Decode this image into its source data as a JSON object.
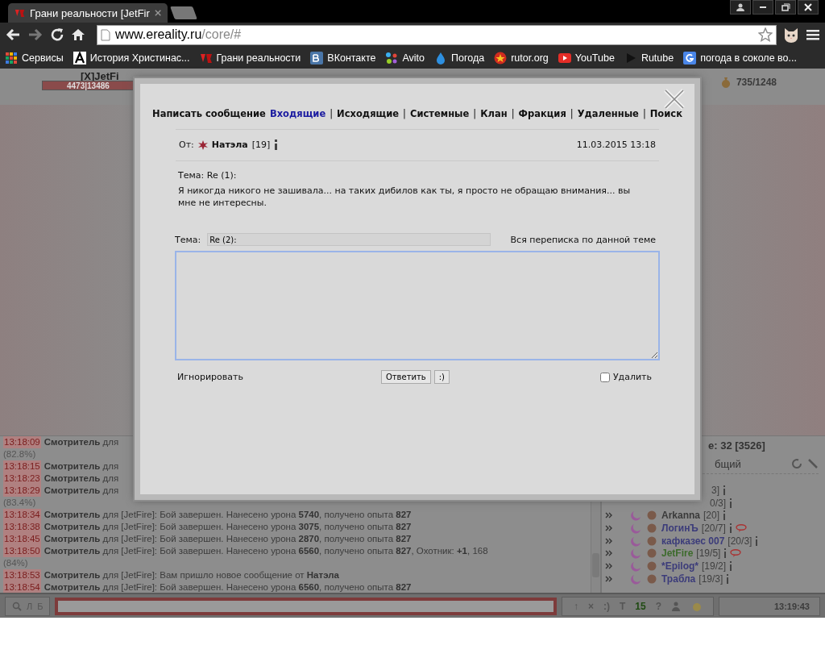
{
  "browser": {
    "tab_title": "Грани реальности [JetFir",
    "url_host": "www.ereality.ru",
    "url_path": "/core/#",
    "bookmarks": [
      {
        "label": "Сервисы",
        "kind": "apps"
      },
      {
        "label": "История Христинас...",
        "kind": "letter"
      },
      {
        "label": "Грани реальности",
        "kind": "logo"
      },
      {
        "label": "ВКонтакте",
        "kind": "vk"
      },
      {
        "label": "Avito",
        "kind": "dots"
      },
      {
        "label": "Погода",
        "kind": "drop"
      },
      {
        "label": "rutor.org",
        "kind": "star"
      },
      {
        "label": "YouTube",
        "kind": "play"
      },
      {
        "label": "Rutube",
        "kind": "triangle"
      },
      {
        "label": "погода в соколе во...",
        "kind": "search"
      }
    ]
  },
  "game": {
    "player": "[X]JetFi",
    "hp": "4473|13486",
    "money": "735/1248",
    "chat_log": [
      {
        "kind": "line",
        "time": "13:18:09",
        "text": "**Смотритель** для"
      },
      {
        "kind": "cont",
        "text": "(82.8%)"
      },
      {
        "kind": "line",
        "time": "13:18:15",
        "text": "**Смотритель** для"
      },
      {
        "kind": "line",
        "time": "13:18:23",
        "text": "**Смотритель** для"
      },
      {
        "kind": "line",
        "time": "13:18:29",
        "text": "**Смотритель** для"
      },
      {
        "kind": "cont",
        "text": "(83.4%)"
      },
      {
        "kind": "line",
        "time": "13:18:34",
        "text": "**Смотритель** для [JetFire]: Бой завершен. Нанесено урона **5740**, получено опыта **827**"
      },
      {
        "kind": "line",
        "time": "13:18:38",
        "text": "**Смотритель** для [JetFire]: Бой завершен. Нанесено урона **3075**, получено опыта **827**"
      },
      {
        "kind": "line",
        "time": "13:18:45",
        "text": "**Смотритель** для [JetFire]: Бой завершен. Нанесено урона **2870**, получено опыта **827**"
      },
      {
        "kind": "line",
        "time": "13:18:50",
        "text": "**Смотритель** для [JetFire]: Бой завершен. Нанесено урона **6560**, получено опыта **827**, Охотник: **+1**, 168"
      },
      {
        "kind": "cont",
        "text": "(84%)"
      },
      {
        "kind": "line",
        "time": "13:18:53",
        "text": "**Смотритель** для [JetFire]: Вам пришло новое сообщение от **Натэла**"
      },
      {
        "kind": "line",
        "time": "13:18:54",
        "text": "**Смотритель** для [JetFire]: Бой завершен. Нанесено урона **6560**, получено опыта **827**"
      }
    ],
    "online": "e: 32 [3526]",
    "channel": "бщий",
    "players": [
      {
        "kind": "partial",
        "level": "3]"
      },
      {
        "kind": "partial",
        "level": "0/3]"
      },
      {
        "kind": "player",
        "name": "Arkanna",
        "level": "[20]",
        "color": "#3a3a3a",
        "chat": false
      },
      {
        "kind": "player",
        "name": "ЛогинЪ",
        "level": "[20/7]",
        "color": "#3c3c7a",
        "chat": true
      },
      {
        "kind": "player",
        "name": "кафказес 007",
        "level": "[20/3]",
        "color": "#3c3c7a",
        "chat": false
      },
      {
        "kind": "player",
        "name": "JetFire",
        "level": "[19/5]",
        "color": "#3d6b2c",
        "chat": true
      },
      {
        "kind": "player",
        "name": "*Epilog*",
        "level": "[19/2]",
        "color": "#3c3c7a",
        "chat": false
      },
      {
        "kind": "player",
        "name": "Трабла",
        "level": "[19/3]",
        "color": "#3c3c7a",
        "chat": false
      }
    ],
    "left_buttons": [
      "Л",
      "Б"
    ],
    "tools": [
      "↑",
      "×",
      ":)",
      "T",
      "15",
      "?"
    ],
    "clock": "13:19:43"
  },
  "dialog": {
    "tabs": [
      {
        "label": "Написать сообщение",
        "selected": false
      },
      {
        "label": "Входящие",
        "selected": true
      },
      {
        "separator": "|",
        "label": "Исходящие",
        "selected": false
      },
      {
        "separator": "|",
        "label": "Системные",
        "selected": false
      },
      {
        "separator": "|",
        "label": "Клан",
        "selected": false
      },
      {
        "separator": "|",
        "label": "Фракция",
        "selected": false
      },
      {
        "separator": "|",
        "label": "Удаленные",
        "selected": false
      },
      {
        "separator": "|",
        "label": "Поиск",
        "selected": false
      }
    ],
    "from_label": "От:",
    "sender": "Натэла",
    "sender_level": "[19]",
    "date": "11.03.2015 13:18",
    "subject": "Тема: Re (1):",
    "body": "Я никогда никого не зашивала... на таких дибилов как ты, я просто не обращаю внимания... вы мне не интересны.",
    "reply_subject_label": "Тема:",
    "reply_subject_value": "Re (2):",
    "thread_link": "Вся переписка по данной теме",
    "ignore_link": "Игнорировать",
    "reply_button": "Ответить",
    "smiley_button": ":)",
    "delete_label": "Удалить",
    "delete_checked": false
  }
}
